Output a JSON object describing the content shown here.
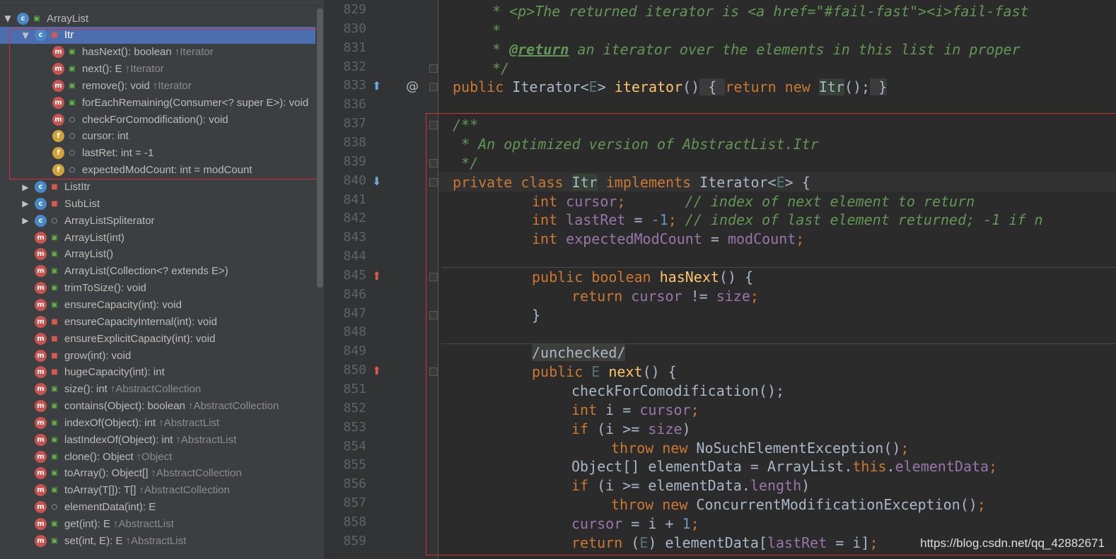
{
  "structure": {
    "items": [
      {
        "label": "ArrayList",
        "suffix": "",
        "kind": "c",
        "vis": "public",
        "arrow": "expanded",
        "depth": 0,
        "selected": false
      },
      {
        "label": "Itr",
        "suffix": "",
        "kind": "c",
        "vis": "private",
        "arrow": "expanded",
        "depth": 1,
        "selected": true
      },
      {
        "label": "hasNext(): boolean",
        "suffix": "↑Iterator",
        "kind": "m",
        "vis": "public",
        "arrow": "none",
        "depth": 2,
        "selected": false
      },
      {
        "label": "next(): E",
        "suffix": "↑Iterator",
        "kind": "m",
        "vis": "public",
        "arrow": "none",
        "depth": 2,
        "selected": false
      },
      {
        "label": "remove(): void",
        "suffix": "↑Iterator",
        "kind": "m",
        "vis": "public",
        "arrow": "none",
        "depth": 2,
        "selected": false
      },
      {
        "label": "forEachRemaining(Consumer<? super E>): void",
        "suffix": "",
        "kind": "m",
        "vis": "public",
        "arrow": "none",
        "depth": 2,
        "selected": false
      },
      {
        "label": "checkForComodification(): void",
        "suffix": "",
        "kind": "m",
        "vis": "package",
        "arrow": "none",
        "depth": 2,
        "selected": false
      },
      {
        "label": "cursor: int",
        "suffix": "",
        "kind": "f",
        "vis": "package",
        "arrow": "none",
        "depth": 2,
        "selected": false
      },
      {
        "label": "lastRet: int = -1",
        "suffix": "",
        "kind": "f",
        "vis": "package",
        "arrow": "none",
        "depth": 2,
        "selected": false
      },
      {
        "label": "expectedModCount: int = modCount",
        "suffix": "",
        "kind": "f",
        "vis": "package",
        "arrow": "none",
        "depth": 2,
        "selected": false
      },
      {
        "label": "ListItr",
        "suffix": "",
        "kind": "c",
        "vis": "private",
        "arrow": "collapsed",
        "depth": 1,
        "selected": false
      },
      {
        "label": "SubList",
        "suffix": "",
        "kind": "c",
        "vis": "private",
        "arrow": "collapsed",
        "depth": 1,
        "selected": false
      },
      {
        "label": "ArrayListSpliterator",
        "suffix": "",
        "kind": "c",
        "vis": "package",
        "arrow": "collapsed",
        "depth": 1,
        "selected": false
      },
      {
        "label": "ArrayList(int)",
        "suffix": "",
        "kind": "m",
        "vis": "public",
        "arrow": "none",
        "depth": 1,
        "selected": false
      },
      {
        "label": "ArrayList()",
        "suffix": "",
        "kind": "m",
        "vis": "public",
        "arrow": "none",
        "depth": 1,
        "selected": false
      },
      {
        "label": "ArrayList(Collection<? extends E>)",
        "suffix": "",
        "kind": "m",
        "vis": "public",
        "arrow": "none",
        "depth": 1,
        "selected": false
      },
      {
        "label": "trimToSize(): void",
        "suffix": "",
        "kind": "m",
        "vis": "public",
        "arrow": "none",
        "depth": 1,
        "selected": false
      },
      {
        "label": "ensureCapacity(int): void",
        "suffix": "",
        "kind": "m",
        "vis": "public",
        "arrow": "none",
        "depth": 1,
        "selected": false
      },
      {
        "label": "ensureCapacityInternal(int): void",
        "suffix": "",
        "kind": "m",
        "vis": "private",
        "arrow": "none",
        "depth": 1,
        "selected": false
      },
      {
        "label": "ensureExplicitCapacity(int): void",
        "suffix": "",
        "kind": "m",
        "vis": "private",
        "arrow": "none",
        "depth": 1,
        "selected": false
      },
      {
        "label": "grow(int): void",
        "suffix": "",
        "kind": "m",
        "vis": "private",
        "arrow": "none",
        "depth": 1,
        "selected": false
      },
      {
        "label": "hugeCapacity(int): int",
        "suffix": "",
        "kind": "m",
        "vis": "private",
        "arrow": "none",
        "depth": 1,
        "selected": false
      },
      {
        "label": "size(): int",
        "suffix": "↑AbstractCollection",
        "kind": "m",
        "vis": "public",
        "arrow": "none",
        "depth": 1,
        "selected": false
      },
      {
        "label": "contains(Object): boolean",
        "suffix": "↑AbstractCollection",
        "kind": "m",
        "vis": "public",
        "arrow": "none",
        "depth": 1,
        "selected": false
      },
      {
        "label": "indexOf(Object): int",
        "suffix": "↑AbstractList",
        "kind": "m",
        "vis": "public",
        "arrow": "none",
        "depth": 1,
        "selected": false
      },
      {
        "label": "lastIndexOf(Object): int",
        "suffix": "↑AbstractList",
        "kind": "m",
        "vis": "public",
        "arrow": "none",
        "depth": 1,
        "selected": false
      },
      {
        "label": "clone(): Object",
        "suffix": "↑Object",
        "kind": "m",
        "vis": "public",
        "arrow": "none",
        "depth": 1,
        "selected": false
      },
      {
        "label": "toArray(): Object[]",
        "suffix": "↑AbstractCollection",
        "kind": "m",
        "vis": "public",
        "arrow": "none",
        "depth": 1,
        "selected": false
      },
      {
        "label": "toArray(T[]): T[]",
        "suffix": "↑AbstractCollection",
        "kind": "m",
        "vis": "public",
        "arrow": "none",
        "depth": 1,
        "selected": false
      },
      {
        "label": "elementData(int): E",
        "suffix": "",
        "kind": "m",
        "vis": "package",
        "arrow": "none",
        "depth": 1,
        "selected": false
      },
      {
        "label": "get(int): E",
        "suffix": "↑AbstractList",
        "kind": "m",
        "vis": "public",
        "arrow": "none",
        "depth": 1,
        "selected": false
      },
      {
        "label": "set(int, E): E",
        "suffix": "↑AbstractList",
        "kind": "m",
        "vis": "public",
        "arrow": "none",
        "depth": 1,
        "selected": false
      }
    ]
  },
  "editor": {
    "lines": [
      {
        "no": "829",
        "mark": "",
        "fold": false,
        "tokens": [
          [
            "cmt",
            "* <p>The returned iterator is <a href=\"#fail-fast\"><i>fail-fast"
          ]
        ],
        "indent": 0
      },
      {
        "no": "830",
        "mark": "",
        "fold": false,
        "tokens": [
          [
            "cmt",
            "*"
          ]
        ],
        "indent": 0
      },
      {
        "no": "831",
        "mark": "",
        "fold": false,
        "tokens": [
          [
            "cmt",
            "* "
          ],
          [
            "cmt-tag",
            "@return"
          ],
          [
            "cmt",
            " an iterator over the elements in this list in proper"
          ]
        ],
        "indent": 0
      },
      {
        "no": "832",
        "mark": "",
        "fold": true,
        "tokens": [
          [
            "cmt",
            "*/"
          ]
        ],
        "indent": 0
      },
      {
        "no": "833",
        "mark": "override-up",
        "fold": true,
        "tokens": [
          [
            "kw",
            "public "
          ],
          [
            "plain",
            "Iterator<"
          ],
          [
            "gen",
            "E"
          ],
          [
            "plain",
            "> "
          ],
          [
            "fn",
            "iterator"
          ],
          [
            "plain",
            "()"
          ],
          [
            "fold-box",
            " { "
          ],
          [
            "kw",
            "return new "
          ],
          [
            "hl-ident",
            "Itr"
          ],
          [
            "plain",
            "();"
          ],
          [
            "fold-box",
            " }"
          ]
        ],
        "indent": -1
      },
      {
        "no": "836",
        "mark": "",
        "fold": false,
        "tokens": [],
        "indent": 0
      },
      {
        "no": "837",
        "mark": "",
        "fold": true,
        "tokens": [
          [
            "cmt",
            "/**"
          ]
        ],
        "indent": -1
      },
      {
        "no": "838",
        "mark": "",
        "fold": false,
        "tokens": [
          [
            "cmt",
            " * An optimized version of AbstractList.Itr"
          ]
        ],
        "indent": -1
      },
      {
        "no": "839",
        "mark": "",
        "fold": true,
        "tokens": [
          [
            "cmt",
            " */"
          ]
        ],
        "indent": -1
      },
      {
        "no": "840",
        "mark": "implements-down",
        "fold": true,
        "tokens": [
          [
            "kw",
            "private class "
          ],
          [
            "hl-ident",
            "Itr"
          ],
          [
            "kw",
            " implements "
          ],
          [
            "plain",
            "Iterator<"
          ],
          [
            "gen",
            "E"
          ],
          [
            "plain",
            "> {"
          ]
        ],
        "indent": -1
      },
      {
        "no": "841",
        "mark": "",
        "fold": false,
        "tokens": [
          [
            "kw",
            "int "
          ],
          [
            "field",
            "cursor"
          ],
          [
            "kw",
            ";"
          ],
          [
            "cmt",
            "       // index of next element to return"
          ]
        ],
        "indent": 1
      },
      {
        "no": "842",
        "mark": "",
        "fold": false,
        "tokens": [
          [
            "kw",
            "int "
          ],
          [
            "field",
            "lastRet"
          ],
          [
            "plain",
            " = "
          ],
          [
            "num",
            "-1"
          ],
          [
            "kw",
            ";"
          ],
          [
            "cmt",
            " // index of last element returned; -1 if n"
          ]
        ],
        "indent": 1
      },
      {
        "no": "843",
        "mark": "",
        "fold": false,
        "tokens": [
          [
            "kw",
            "int "
          ],
          [
            "field",
            "expectedModCount"
          ],
          [
            "plain",
            " = "
          ],
          [
            "field",
            "modCount"
          ],
          [
            "kw",
            ";"
          ]
        ],
        "indent": 1
      },
      {
        "no": "844",
        "mark": "",
        "fold": false,
        "tokens": [],
        "indent": 0
      },
      {
        "no": "845",
        "mark": "implements-up",
        "fold": true,
        "tokens": [
          [
            "kw",
            "public boolean "
          ],
          [
            "fn",
            "hasNext"
          ],
          [
            "plain",
            "() {"
          ]
        ],
        "indent": 1
      },
      {
        "no": "846",
        "mark": "",
        "fold": false,
        "tokens": [
          [
            "kw",
            "return "
          ],
          [
            "field",
            "cursor"
          ],
          [
            "plain",
            " != "
          ],
          [
            "field",
            "size"
          ],
          [
            "kw",
            ";"
          ]
        ],
        "indent": 2
      },
      {
        "no": "847",
        "mark": "",
        "fold": true,
        "tokens": [
          [
            "plain",
            "}"
          ]
        ],
        "indent": 1
      },
      {
        "no": "848",
        "mark": "",
        "fold": false,
        "tokens": [],
        "indent": 0
      },
      {
        "no": "849",
        "mark": "",
        "fold": false,
        "tokens": [
          [
            "annot-box",
            "/unchecked/"
          ]
        ],
        "indent": 1
      },
      {
        "no": "850",
        "mark": "implements-up",
        "fold": true,
        "tokens": [
          [
            "kw",
            "public "
          ],
          [
            "gen",
            "E "
          ],
          [
            "fn",
            "next"
          ],
          [
            "plain",
            "() {"
          ]
        ],
        "indent": 1
      },
      {
        "no": "851",
        "mark": "",
        "fold": false,
        "tokens": [
          [
            "plain",
            "checkForComodification();"
          ]
        ],
        "indent": 2
      },
      {
        "no": "852",
        "mark": "",
        "fold": false,
        "tokens": [
          [
            "kw",
            "int "
          ],
          [
            "plain",
            "i = "
          ],
          [
            "field",
            "cursor"
          ],
          [
            "kw",
            ";"
          ]
        ],
        "indent": 2
      },
      {
        "no": "853",
        "mark": "",
        "fold": false,
        "tokens": [
          [
            "kw",
            "if "
          ],
          [
            "plain",
            "(i >= "
          ],
          [
            "field",
            "size"
          ],
          [
            "plain",
            ")"
          ]
        ],
        "indent": 2
      },
      {
        "no": "854",
        "mark": "",
        "fold": false,
        "tokens": [
          [
            "kw",
            "throw new "
          ],
          [
            "plain",
            "NoSuchElementException()"
          ],
          [
            "kw",
            ";"
          ]
        ],
        "indent": 3
      },
      {
        "no": "855",
        "mark": "",
        "fold": false,
        "tokens": [
          [
            "plain",
            "Object[] elementData = ArrayList."
          ],
          [
            "kw",
            "this"
          ],
          [
            "plain",
            "."
          ],
          [
            "field",
            "elementData"
          ],
          [
            "kw",
            ";"
          ]
        ],
        "indent": 2
      },
      {
        "no": "856",
        "mark": "",
        "fold": false,
        "tokens": [
          [
            "kw",
            "if "
          ],
          [
            "plain",
            "(i >= elementData."
          ],
          [
            "field",
            "length"
          ],
          [
            "plain",
            ")"
          ]
        ],
        "indent": 2
      },
      {
        "no": "857",
        "mark": "",
        "fold": false,
        "tokens": [
          [
            "kw",
            "throw new "
          ],
          [
            "plain",
            "ConcurrentModificationException()"
          ],
          [
            "kw",
            ";"
          ]
        ],
        "indent": 3
      },
      {
        "no": "858",
        "mark": "",
        "fold": false,
        "tokens": [
          [
            "field",
            "cursor"
          ],
          [
            "plain",
            " = i + "
          ],
          [
            "num",
            "1"
          ],
          [
            "kw",
            ";"
          ]
        ],
        "indent": 2
      },
      {
        "no": "859",
        "mark": "",
        "fold": false,
        "tokens": [
          [
            "kw",
            "return "
          ],
          [
            "plain",
            "("
          ],
          [
            "gen",
            "E"
          ],
          [
            "plain",
            ") elementData["
          ],
          [
            "field",
            "lastRet"
          ],
          [
            "plain",
            " = i]"
          ],
          [
            "kw",
            ";"
          ]
        ],
        "indent": 2
      }
    ],
    "at_mark": "@",
    "watermark": "https://blog.csdn.net/qq_42882671"
  },
  "colors": {
    "selection": "#4b6eaf",
    "highlight_border": "#d93030",
    "keyword": "#cc7832",
    "comment": "#629755",
    "field": "#9876aa",
    "method": "#ffc66d"
  }
}
